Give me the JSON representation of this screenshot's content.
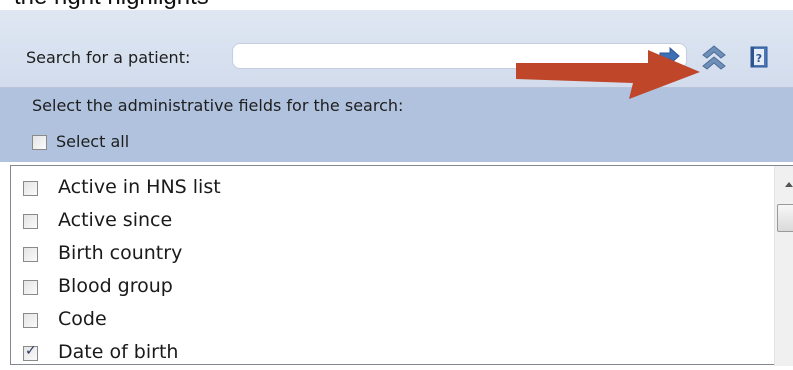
{
  "top_text": "the right highlights",
  "search": {
    "label": "Search for a patient:",
    "value": "",
    "placeholder": ""
  },
  "toolbar": {
    "icons": [
      "search-arrow-icon",
      "collapse-up-icon",
      "help-book-icon"
    ]
  },
  "admin": {
    "title": "Select the administrative fields for the search:",
    "select_all_label": "Select all",
    "select_all_checked": false
  },
  "fields": [
    {
      "label": "Active in HNS list",
      "checked": false
    },
    {
      "label": "Active since",
      "checked": false
    },
    {
      "label": "Birth country",
      "checked": false
    },
    {
      "label": "Blood group",
      "checked": false
    },
    {
      "label": "Code",
      "checked": false
    },
    {
      "label": "Date of birth",
      "checked": true
    }
  ],
  "annotation": {
    "arrow_color": "#c0462a"
  },
  "colors": {
    "search_bar": "#d7e0ef",
    "admin_panel": "#b0c2dd",
    "list_border": "#828790"
  }
}
